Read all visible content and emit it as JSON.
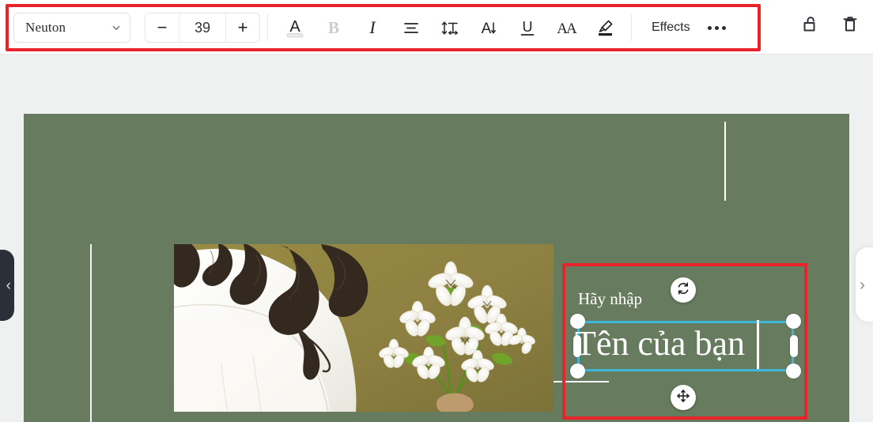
{
  "toolbar": {
    "font": {
      "name": "Neuton",
      "icon": "chevron-down-icon"
    },
    "size": {
      "decrease": "−",
      "value": "39",
      "increase": "+"
    },
    "icons": [
      {
        "name": "text-color-icon",
        "label": "A"
      },
      {
        "name": "bold-icon",
        "label": "B",
        "disabled": true
      },
      {
        "name": "italic-icon",
        "label": "I"
      },
      {
        "name": "text-align-icon",
        "label": "align"
      },
      {
        "name": "line-spacing-icon",
        "label": "line-spacing"
      },
      {
        "name": "letter-spacing-icon",
        "label": "letter-spacing"
      },
      {
        "name": "underline-icon",
        "label": "U"
      },
      {
        "name": "font-case-icon",
        "label": "AA"
      },
      {
        "name": "highlighter-icon",
        "label": "highlight"
      }
    ],
    "effects_label": "Effects",
    "more_label": "•••",
    "unlock_label": "unlock-icon",
    "delete_label": "trash-icon"
  },
  "canvas": {
    "background_color": "#677b5e",
    "photo": {
      "alt": "woman-in-white-blouse-with-white-flowers"
    },
    "text_block": {
      "prompt": "Hãy nhập",
      "value": "Tên của bạn",
      "selection_color": "#3fb6dc",
      "rotate_icon": "rotate-icon",
      "move_icon": "move-icon"
    }
  },
  "panels": {
    "left_collapse": "‹",
    "right_expand": "›"
  },
  "highlight_color": "#e8242a"
}
